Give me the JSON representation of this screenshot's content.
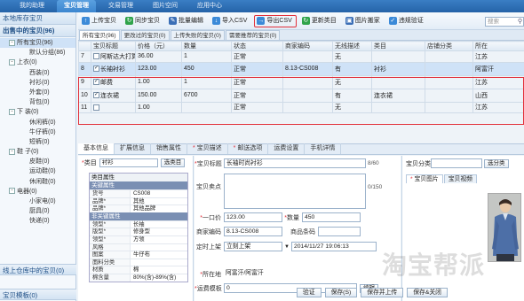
{
  "topnav": {
    "tabs": [
      "我的助理",
      "宝贝管理",
      "交易管理",
      "图片空间",
      "应用中心"
    ],
    "active": 1
  },
  "sidebar": {
    "header": "本地库存宝贝",
    "section": "出售中的宝贝(96)",
    "items": [
      {
        "label": "所有宝贝(96)",
        "level": 1,
        "toggle": "-",
        "selected": true
      },
      {
        "label": "默认分组(86)",
        "level": 2
      },
      {
        "label": "上衣(0)",
        "level": 1,
        "toggle": "-"
      },
      {
        "label": "西装(0)",
        "level": 2
      },
      {
        "label": "衬衫(0)",
        "level": 2
      },
      {
        "label": "外套(0)",
        "level": 2
      },
      {
        "label": "背包(0)",
        "level": 2
      },
      {
        "label": "下 装(0)",
        "level": 1,
        "toggle": "-"
      },
      {
        "label": "休闲裤(0)",
        "level": 2
      },
      {
        "label": "牛仔裤(0)",
        "level": 2
      },
      {
        "label": "短裤(0)",
        "level": 2
      },
      {
        "label": "鞋 子(0)",
        "level": 1,
        "toggle": "-"
      },
      {
        "label": "皮鞋(0)",
        "level": 2
      },
      {
        "label": "运动鞋(0)",
        "level": 2
      },
      {
        "label": "休闲鞋(0)",
        "level": 2
      },
      {
        "label": "电器(0)",
        "level": 1,
        "toggle": "-"
      },
      {
        "label": "小家电(0)",
        "level": 2
      },
      {
        "label": "厨具(0)",
        "level": 2
      },
      {
        "label": "快递(0)",
        "level": 2
      }
    ],
    "footer1": "线上仓库中的宝贝(0)",
    "footer2": "宝贝模板(0)"
  },
  "toolbar": {
    "buttons": [
      {
        "label": "上传宝贝",
        "icon": "upload-icon",
        "color": "#3b8ad8"
      },
      {
        "label": "同步宝贝",
        "icon": "sync-icon",
        "color": "#2fa34a"
      },
      {
        "label": "批量编辑",
        "icon": "edit-icon",
        "color": "#3b6fb6"
      },
      {
        "label": "导入CSV",
        "icon": "import-icon",
        "color": "#3b8ad8"
      },
      {
        "label": "导出CSV",
        "icon": "export-icon",
        "color": "#3b8ad8",
        "highlighted": true
      },
      {
        "label": "更新类目",
        "icon": "update-icon",
        "color": "#2fa34a"
      },
      {
        "label": "图片搬家",
        "icon": "image-move-icon",
        "color": "#3b6fb6"
      },
      {
        "label": "违规验证",
        "icon": "check-icon",
        "color": "#3b8ad8"
      }
    ],
    "search_placeholder": "搜索"
  },
  "gridtabs": [
    "所有宝贝(96)",
    "更改过的宝贝(0)",
    "上传失败的宝贝(0)",
    "需要推荐的宝贝(0)"
  ],
  "grid": {
    "columns": [
      "",
      "宝贝标题",
      "价格（元）",
      "数量",
      "状态",
      "商家编码",
      "无线描述",
      "类目",
      "店铺分类",
      "所在"
    ],
    "rows": [
      {
        "num": "7",
        "title": "阿斯达大打算",
        "price": "36.00",
        "qty": "1",
        "status": "正常",
        "code": "",
        "wireless": "无",
        "category": "",
        "shop": "",
        "loc": "江苏"
      },
      {
        "num": "8",
        "title": "长袖衬衫",
        "price": "123.00",
        "qty": "450",
        "status": "正常",
        "code": "8.13-CS008",
        "wireless": "有",
        "category": "衬衫",
        "shop": "",
        "loc": "阿富汗",
        "selected": true,
        "checked": true
      },
      {
        "num": "9",
        "title": "邮费",
        "price": "1.00",
        "qty": "1",
        "status": "正常",
        "code": "",
        "wireless": "无",
        "category": "",
        "shop": "",
        "loc": "江苏",
        "checked": true
      },
      {
        "num": "10",
        "title": "连衣裙",
        "price": "150.00",
        "qty": "6700",
        "status": "正常",
        "code": "",
        "wireless": "有",
        "category": "连衣裙",
        "shop": "",
        "loc": "山西",
        "checked": true
      },
      {
        "num": "11",
        "title": "",
        "price": "1.00",
        "qty": "",
        "status": "正常",
        "code": "",
        "wireless": "无",
        "category": "",
        "shop": "",
        "loc": "江苏"
      }
    ]
  },
  "detail": {
    "tabs": [
      "基本信息",
      "扩展信息",
      "销售属性",
      "宝贝描述",
      "邮送选项",
      "运费设置",
      "手机详情"
    ],
    "category_label": "类目",
    "category_value": "衬衫",
    "category_btn": "选类目",
    "prop_title": "类目属性",
    "prop_sections": [
      {
        "name": "关键属性",
        "rows": [
          {
            "k": "货号",
            "v": "CS008"
          },
          {
            "k": "品牌*",
            "v": "其他"
          },
          {
            "k": "品牌*",
            "v": "其他品牌"
          }
        ]
      },
      {
        "name": "非关键属性",
        "rows": [
          {
            "k": "领型*",
            "v": "长袖"
          },
          {
            "k": "版型*",
            "v": "修身型"
          },
          {
            "k": "领型*",
            "v": "方领"
          },
          {
            "k": "风格",
            "v": ""
          },
          {
            "k": "图案",
            "v": "牛仔布"
          },
          {
            "k": "面料分类",
            "v": ""
          },
          {
            "k": "材质",
            "v": "棉"
          },
          {
            "k": "棉含量",
            "v": "80%(含)-89%(含)"
          }
        ]
      }
    ],
    "form": {
      "title_label": "宝贝标题",
      "title_value": "长袖时尚衬衫",
      "title_count": "8/60",
      "selling_label": "宝贝卖点",
      "selling_count": "0/150",
      "price_label": "一口价",
      "price_value": "123.00",
      "qty_label": "数量",
      "qty_value": "450",
      "code_label": "商家编码",
      "code_value": "8.13-CS008",
      "barcode_label": "商品条码",
      "time_label": "定时上架",
      "time_mode": "立刻上架",
      "time_value": "2014/11/27 19:06:13",
      "loc_label": "所在地",
      "loc_value": "阿富汗/阿富汗",
      "ship_label": "运费模板",
      "ship_value": "0",
      "ship_btn": "编辑"
    },
    "right": {
      "cat_label": "宝贝分类",
      "cat_btn": "选分类",
      "tabs": [
        "宝贝图片",
        "宝贝视频"
      ]
    },
    "footer_buttons": [
      "验证",
      "保存(S)",
      "保存并上传",
      "保存&关闭"
    ]
  },
  "watermark": "淘宝帮派"
}
